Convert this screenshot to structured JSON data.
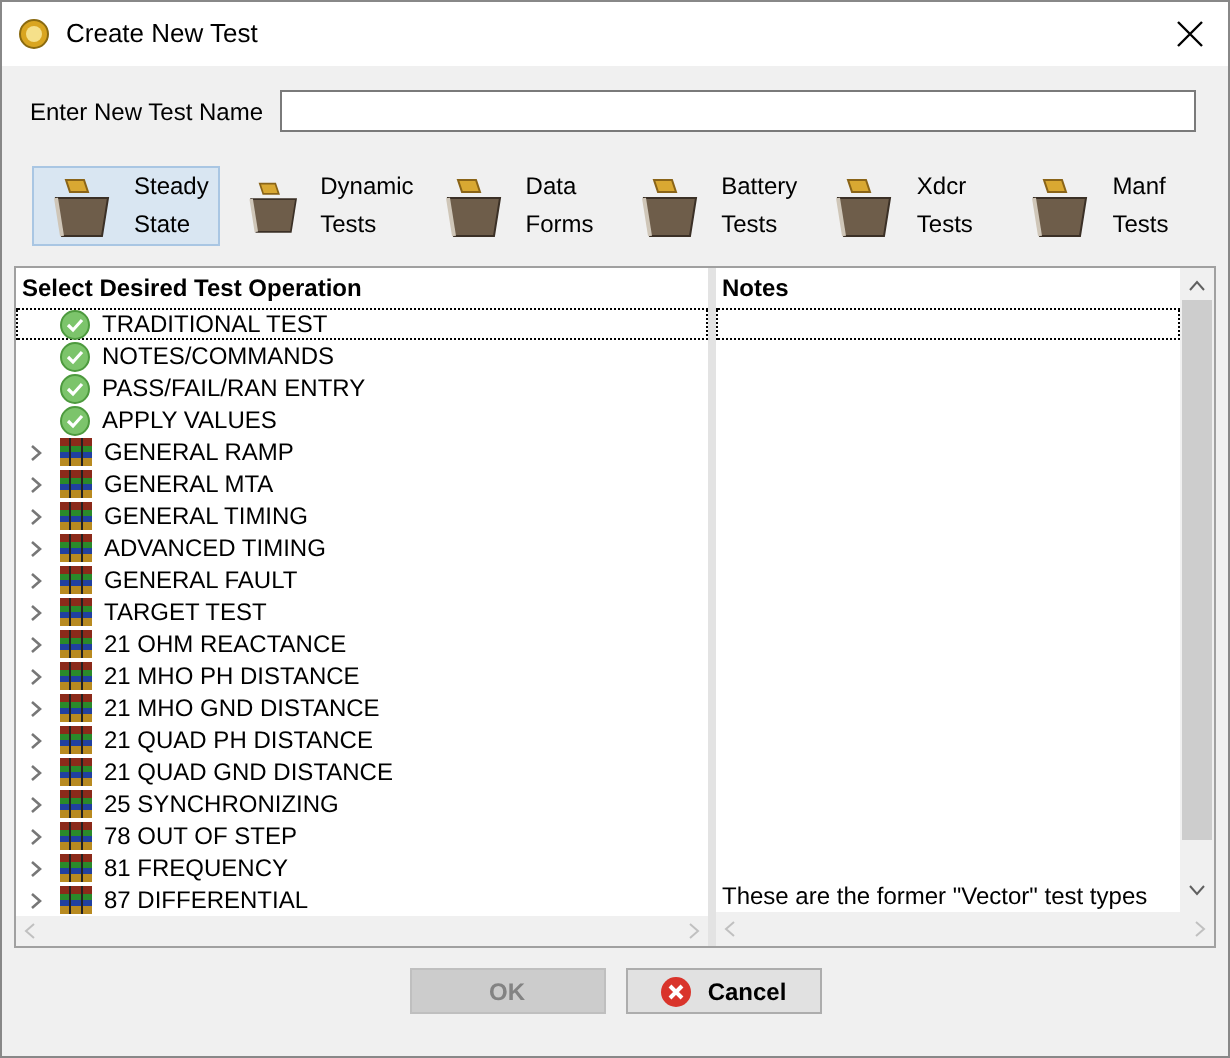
{
  "window": {
    "title": "Create New Test"
  },
  "name_field": {
    "label": "Enter New Test Name"
  },
  "categories": [
    {
      "line1": "Steady",
      "line2": "State",
      "selected": true
    },
    {
      "line1": "Dynamic",
      "line2": "Tests",
      "selected": false
    },
    {
      "line1": "Data",
      "line2": "Forms",
      "selected": false
    },
    {
      "line1": "Battery",
      "line2": "Tests",
      "selected": false
    },
    {
      "line1": "Xdcr",
      "line2": "Tests",
      "selected": false
    },
    {
      "line1": "Manf",
      "line2": "Tests",
      "selected": false
    }
  ],
  "operations": {
    "header": "Select Desired Test Operation",
    "items": [
      {
        "label": "TRADITIONAL TEST",
        "kind": "check",
        "selected": true
      },
      {
        "label": "NOTES/COMMANDS",
        "kind": "check",
        "selected": false
      },
      {
        "label": "PASS/FAIL/RAN ENTRY",
        "kind": "check",
        "selected": false
      },
      {
        "label": "APPLY VALUES",
        "kind": "check",
        "selected": false
      },
      {
        "label": "GENERAL RAMP",
        "kind": "group",
        "selected": false
      },
      {
        "label": "GENERAL MTA",
        "kind": "group",
        "selected": false
      },
      {
        "label": "GENERAL TIMING",
        "kind": "group",
        "selected": false
      },
      {
        "label": "ADVANCED TIMING",
        "kind": "group",
        "selected": false
      },
      {
        "label": "GENERAL FAULT",
        "kind": "group",
        "selected": false
      },
      {
        "label": "TARGET TEST",
        "kind": "group",
        "selected": false
      },
      {
        "label": "21 OHM REACTANCE",
        "kind": "group",
        "selected": false
      },
      {
        "label": "21 MHO PH DISTANCE",
        "kind": "group",
        "selected": false
      },
      {
        "label": "21 MHO GND DISTANCE",
        "kind": "group",
        "selected": false
      },
      {
        "label": "21 QUAD PH DISTANCE",
        "kind": "group",
        "selected": false
      },
      {
        "label": "21 QUAD GND DISTANCE",
        "kind": "group",
        "selected": false
      },
      {
        "label": "25 SYNCHRONIZING",
        "kind": "group",
        "selected": false
      },
      {
        "label": "78 OUT OF STEP",
        "kind": "group",
        "selected": false
      },
      {
        "label": "81 FREQUENCY",
        "kind": "group",
        "selected": false
      },
      {
        "label": "87 DIFFERENTIAL",
        "kind": "group",
        "selected": false
      }
    ]
  },
  "notes": {
    "header": "Notes",
    "text": "These are the former \"Vector\" test types"
  },
  "buttons": [
    {
      "label": "OK",
      "kind": "ok",
      "disabled": true
    },
    {
      "label": "Cancel",
      "kind": "cancel",
      "disabled": false
    }
  ]
}
